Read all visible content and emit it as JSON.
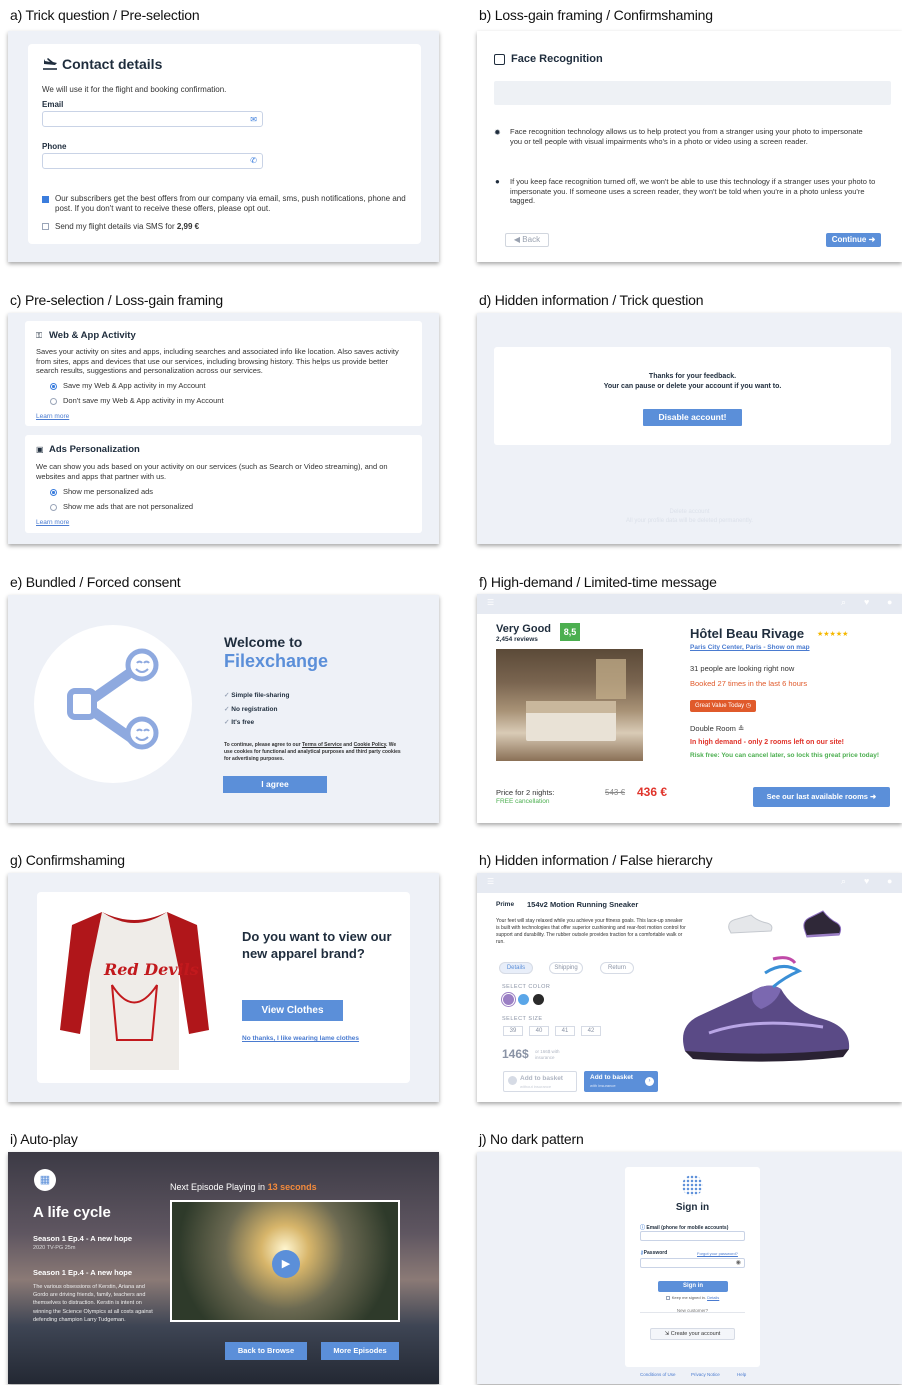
{
  "captions": {
    "a": "a) Trick question / Pre-selection",
    "b": "b) Loss-gain framing / Confirmshaming",
    "c": "c) Pre-selection / Loss-gain framing",
    "d": "d) Hidden information / Trick question",
    "e": "e) Bundled / Forced consent",
    "f": "f) High-demand / Limited-time message",
    "g": "g) Confirmshaming",
    "h": "h) Hidden information / False hierarchy",
    "i": "i) Auto-play",
    "j": "j) No dark pattern"
  },
  "a": {
    "title": "Contact details",
    "subtitle": "We will use it for the flight and booking confirmation.",
    "email_label": "Email",
    "phone_label": "Phone",
    "offers_text": "Our subscribers get the best offers from our company via email, sms, push notifications, phone and post. If you don't want to receive these offers, please opt out.",
    "sms_text": "Send my flight details via SMS for ",
    "sms_price": "2,99 €"
  },
  "b": {
    "title": "Face Recognition",
    "para1": "Face recognition technology allows us to help protect you from a stranger using your photo to impersonate you or tell people with visual impairments who's in a photo or video using a screen reader.",
    "para2": "If you keep face recognition turned off, we won't be able to use this technology if a stranger uses your photo to impersonate you. If someone uses a screen reader, they won't be told when you're in a photo unless you're tagged.",
    "back": "Back",
    "continue": "Continue"
  },
  "c": {
    "web_title": "Web & App Activity",
    "web_desc": "Saves your activity on sites and apps, including searches and associated info like location. Also saves activity from sites, apps and devices that use our services, including browsing history. This helps us provide better search results, suggestions and personalization across our services.",
    "web_opt1": "Save my Web & App activity in my Account",
    "web_opt2": "Don't save my Web & App activity in my Account",
    "learn_more": "Learn more",
    "ads_title": "Ads Personalization",
    "ads_desc": "We can show you ads based on your activity on our services (such as Search or Video streaming), and on websites and apps that partner with us.",
    "ads_opt1": "Show me personalized ads",
    "ads_opt2": "Show me ads that are not personalized"
  },
  "d": {
    "thanks": "Thanks for your feedback.",
    "pause": "Your can pause or delete your account if you want to.",
    "disable": "Disable account!",
    "hidden_link": "Delete account",
    "hidden_note": "All your profile data will be deleted permanently."
  },
  "e": {
    "welcome": "Welcome to",
    "brand": "Filexchange",
    "features": [
      "Simple file-sharing",
      "No registration",
      "It's free"
    ],
    "consent_pre": "To continue, please agree to our ",
    "terms": "Terms of Service",
    "and": " and ",
    "cookie": "Cookie Policy",
    "consent_post": ". We use cookies for functional and analytical purposes and third party cookies for advertising purposes.",
    "agree": "I agree"
  },
  "f": {
    "rating_text": "Very Good",
    "reviews": "2,454 reviews",
    "score": "8,5",
    "hotel": "Hôtel Beau Rivage",
    "stars": "★★★★★",
    "location": "Paris City Center, Paris - Show on map",
    "looking": "31 people are looking right now",
    "booked": "Booked 27 times in the last 6 hours",
    "badge": "Great Value Today",
    "room": "Double Room",
    "demand": "In high demand - only 2 rooms left on our site!",
    "risk": "Risk free: You can cancel later, so lock this great price today!",
    "price_label": "Price for 2 nights:",
    "free_cancel": "FREE cancellation",
    "old_price": "543 €",
    "new_price": "436 €",
    "cta": "See our last available rooms"
  },
  "g": {
    "question": "Do you want to view our new apparel brand?",
    "cta": "View Clothes",
    "decline": "No thanks, I like wearing lame clothes"
  },
  "h": {
    "brand": "Prime",
    "product": "154v2 Motion Running Sneaker",
    "desc": "Your feet will stay relaxed while you achieve your fitness goals. This lace-up sneaker is built with technologies that offer superior cushioning and rear-foot motion control for support and durability. The rubber outsole provides traction for a comfortable walk or run.",
    "tabs": [
      "Details",
      "Shipping",
      "Return"
    ],
    "color_label": "SELECT COLOR",
    "colors": [
      "#9b7fc4",
      "#5aa6e8",
      "#2a2a2a"
    ],
    "size_label": "SELECT SIZE",
    "sizes": [
      "39",
      "40",
      "41",
      "42"
    ],
    "price": "146$",
    "price_note": "or 166$ with insurance",
    "add_plain": "Add to basket",
    "add_plain_sub": "without insurance",
    "add_ins": "Add to basket",
    "add_ins_sub": "with insurance"
  },
  "i": {
    "title": "A life cycle",
    "ep1": "Season 1 Ep.4 - A new hope",
    "meta": "2020 TV-PG 25m",
    "ep2": "Season 1 Ep.4 - A new hope",
    "desc": "The various obsessions of Kerstin, Ariana and Gordo are driving friends, family, teachers and themselves to distraction. Kerstin is intent on winning the Science Olympics at all costs against defending champion Larry Tudgeman.",
    "next_pre": "Next Episode Playing in ",
    "next_time": "13 seconds",
    "browse": "Back to Browse",
    "more": "More Episodes"
  },
  "j": {
    "title": "Sign in",
    "email_label": "Email (phone for mobile accounts)",
    "pw_label": "Password",
    "forgot": "Forgot your password?",
    "signin": "Sign in",
    "keep": "Keep me signed in.",
    "details": "Details",
    "new_customer": "New customer?",
    "create": "Create your account",
    "footer": [
      "Conditions of Use",
      "Privacy Notice",
      "Help"
    ]
  }
}
